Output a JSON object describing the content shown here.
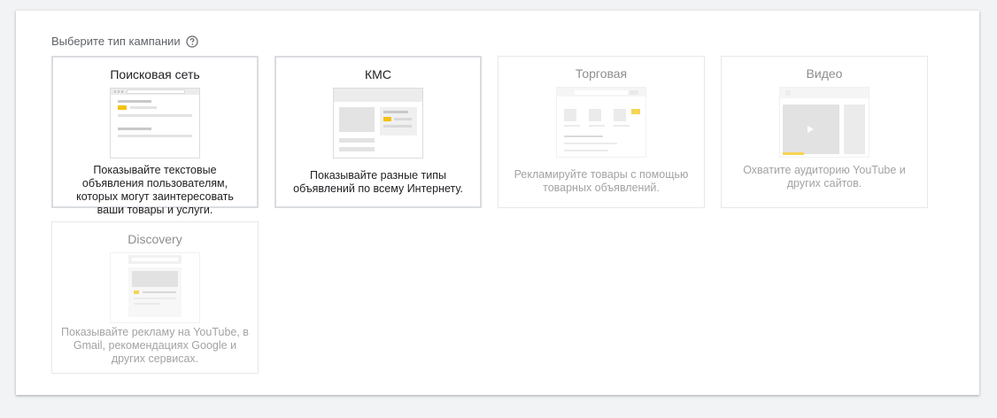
{
  "heading": "Выберите тип кампании",
  "cards": [
    {
      "title": "Поисковая сеть",
      "desc": "Показывайте текстовые объявления пользователям, которых могут заинтересовать ваши товары и услуги.",
      "state": "enabled"
    },
    {
      "title": "КМС",
      "desc": "Показывайте разные типы объявлений по всему Интернету.",
      "state": "enabled"
    },
    {
      "title": "Торговая",
      "desc": "Рекламируйте товары с помощью товарных объявлений.",
      "state": "disabled"
    },
    {
      "title": "Видео",
      "desc": "Охватите аудиторию YouTube и других сайтов.",
      "state": "disabled"
    },
    {
      "title": "Discovery",
      "desc": "Показывайте рекламу на YouTube, в Gmail, рекомендациях Google и других сервисах.",
      "state": "disabled"
    }
  ],
  "colors": {
    "accent": "#f4c20d",
    "background": "#f1f3f4",
    "panel": "#ffffff"
  },
  "icons": {
    "help": "help-circle-icon",
    "play": "play-icon"
  }
}
